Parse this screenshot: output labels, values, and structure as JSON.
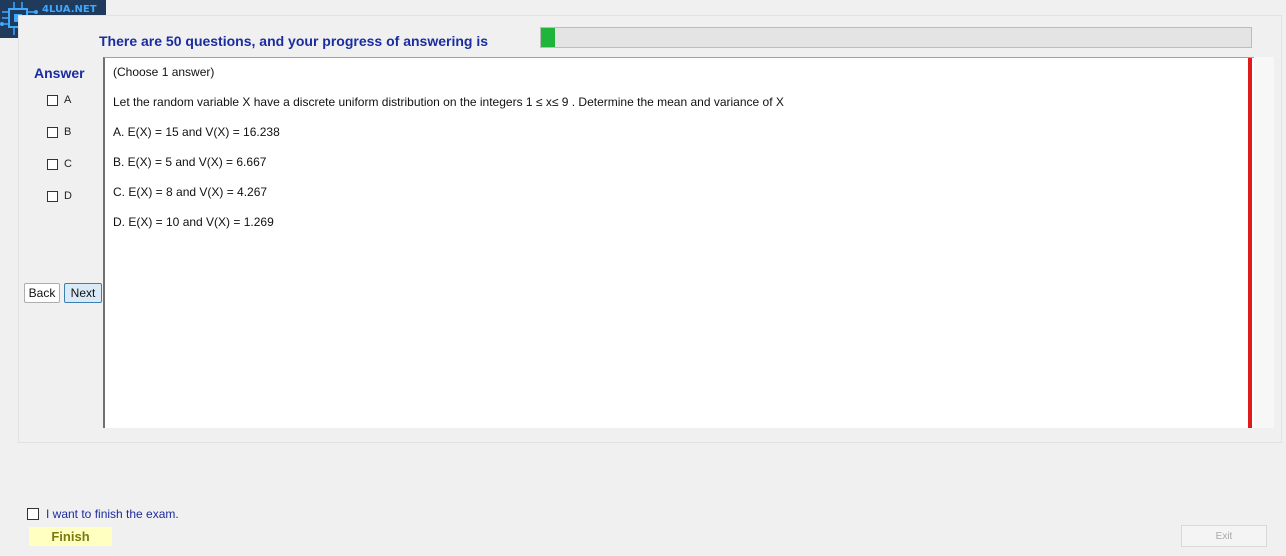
{
  "logo": {
    "text": "4LUA.NET",
    "badge": "17"
  },
  "progress": {
    "text": "There are 50 questions, and your progress of answering is",
    "fraction": 0.02,
    "color": "#1fb43a"
  },
  "answer_panel": {
    "label": "Answer",
    "options": [
      {
        "label": "A",
        "checked": false
      },
      {
        "label": "B",
        "checked": false
      },
      {
        "label": "C",
        "checked": false
      },
      {
        "label": "D",
        "checked": false
      }
    ]
  },
  "nav": {
    "back_label": "Back",
    "next_label": "Next"
  },
  "question": {
    "instruction": "(Choose 1 answer)",
    "prompt": "Let the random variable X have a discrete uniform distribution on the integers   1 ≤ x≤ 9 . Determine the mean and variance of X",
    "choices": [
      "A.  E(X) = 15 and V(X) = 16.238",
      "B.  E(X) = 5 and V(X) = 6.667",
      "C.  E(X) = 8 and V(X) = 4.267",
      "D.  E(X) = 10 and V(X) = 1.269"
    ]
  },
  "accent_colors": {
    "title_blue": "#1b2ca0",
    "marker_red": "#e11b1b"
  },
  "finish": {
    "checkbox_label": "I want to finish the exam.",
    "button_label": "Finish"
  },
  "exit": {
    "label": "Exit"
  }
}
